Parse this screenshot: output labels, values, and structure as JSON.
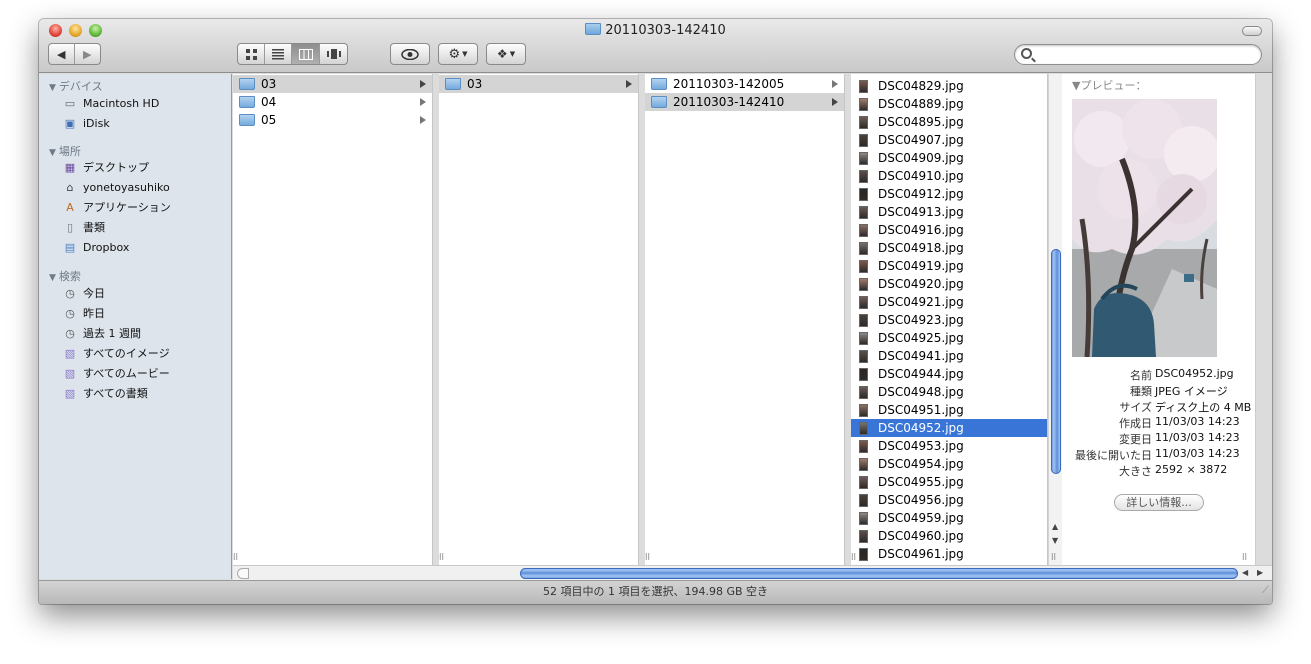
{
  "window": {
    "title": "20110303-142410"
  },
  "toolbar": {
    "back": "◀",
    "forward": "▶",
    "views": [
      "icon",
      "list",
      "column",
      "coverflow"
    ],
    "quicklook": "eye",
    "action": "gear",
    "dropbox": "dropbox",
    "search_placeholder": ""
  },
  "sidebar": {
    "devices_label": "デバイス",
    "devices": [
      {
        "label": "Macintosh HD",
        "icon": "hd-icon"
      },
      {
        "label": "iDisk",
        "icon": "idisk-icon"
      }
    ],
    "places_label": "場所",
    "places": [
      {
        "label": "デスクトップ",
        "icon": "desktop-icon"
      },
      {
        "label": "yonetoyasuhiko",
        "icon": "home-icon"
      },
      {
        "label": "アプリケーション",
        "icon": "applications-icon"
      },
      {
        "label": "書類",
        "icon": "document-icon"
      },
      {
        "label": "Dropbox",
        "icon": "dropbox-folder-icon"
      }
    ],
    "search_label": "検索",
    "searches": [
      {
        "label": "今日",
        "icon": "clock-icon"
      },
      {
        "label": "昨日",
        "icon": "clock-icon"
      },
      {
        "label": "過去 1 週間",
        "icon": "clock-icon"
      },
      {
        "label": "すべてのイメージ",
        "icon": "smart-folder-icon"
      },
      {
        "label": "すべてのムービー",
        "icon": "smart-folder-icon"
      },
      {
        "label": "すべての書類",
        "icon": "smart-folder-icon"
      }
    ]
  },
  "columns": {
    "col1": [
      "03",
      "04",
      "05"
    ],
    "col2": [
      "03"
    ],
    "col3": [
      "20110303-142005",
      "20110303-142410"
    ],
    "files": [
      "DSC04829.jpg",
      "DSC04889.jpg",
      "DSC04895.jpg",
      "DSC04907.jpg",
      "DSC04909.jpg",
      "DSC04910.jpg",
      "DSC04912.jpg",
      "DSC04913.jpg",
      "DSC04916.jpg",
      "DSC04918.jpg",
      "DSC04919.jpg",
      "DSC04920.jpg",
      "DSC04921.jpg",
      "DSC04923.jpg",
      "DSC04925.jpg",
      "DSC04941.jpg",
      "DSC04944.jpg",
      "DSC04948.jpg",
      "DSC04951.jpg",
      "DSC04952.jpg",
      "DSC04953.jpg",
      "DSC04954.jpg",
      "DSC04955.jpg",
      "DSC04956.jpg",
      "DSC04959.jpg",
      "DSC04960.jpg",
      "DSC04961.jpg"
    ],
    "selected_file": "DSC04952.jpg"
  },
  "preview": {
    "header": "プレビュー：",
    "info": [
      {
        "k": "名前",
        "v": "DSC04952.jpg"
      },
      {
        "k": "種類",
        "v": "JPEG イメージ"
      },
      {
        "k": "サイズ",
        "v": "ディスク上の 4 MB"
      },
      {
        "k": "作成日",
        "v": "11/03/03 14:23"
      },
      {
        "k": "変更日",
        "v": "11/03/03 14:23"
      },
      {
        "k": "最後に開いた日",
        "v": "11/03/03 14:23"
      },
      {
        "k": "大きさ",
        "v": "2592 × 3872"
      }
    ],
    "more_button": "詳しい情報..."
  },
  "status": {
    "text": "52 項目中の 1 項目を選択、194.98 GB 空き"
  }
}
